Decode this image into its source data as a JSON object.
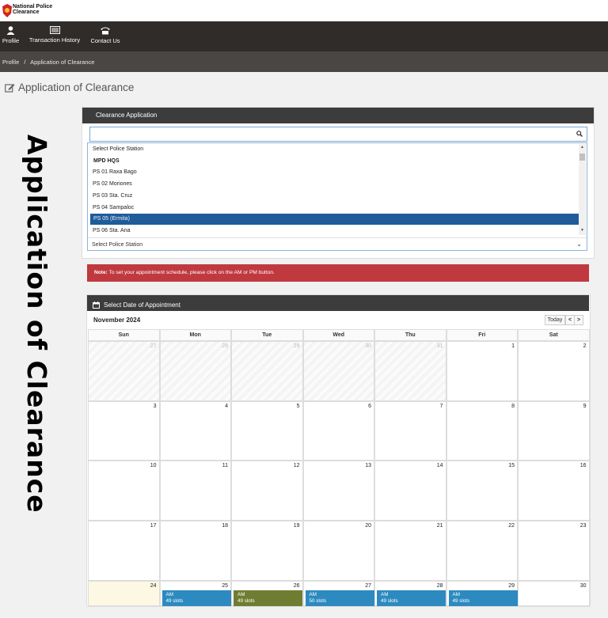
{
  "brand": {
    "line1": "National Police",
    "line2": "Clearance"
  },
  "nav": [
    {
      "label": "Profile",
      "icon": "user-icon"
    },
    {
      "label": "Transaction History",
      "icon": "list-icon"
    },
    {
      "label": "Contact Us",
      "icon": "phone-icon"
    }
  ],
  "breadcrumb": {
    "home": "Profile",
    "sep": "/",
    "current": "Application of Clearance"
  },
  "page_title": "Application of Clearance",
  "side_label": "Application of Clearance",
  "clearance_panel": {
    "title": "Clearance Application",
    "search_value": "",
    "options": [
      {
        "label": "Select Police Station",
        "style": "plain"
      },
      {
        "label": "MPD HQS",
        "style": "bold"
      },
      {
        "label": "PS 01 Raxa Bago",
        "style": "plain"
      },
      {
        "label": "PS 02 Moriones",
        "style": "plain"
      },
      {
        "label": "PS 03 Sta. Cruz",
        "style": "plain"
      },
      {
        "label": "PS 04 Sampaloc",
        "style": "plain"
      },
      {
        "label": "PS 05 (Ermita)",
        "style": "selected"
      },
      {
        "label": "PS 06 Sta. Ana",
        "style": "plain"
      }
    ],
    "select_value": "Select Police Station"
  },
  "note": {
    "prefix": "Note:",
    "text": " To set your appointment schedule, please click on the AM or PM button."
  },
  "calendar": {
    "title": "Select Date of Appointment",
    "month": "November 2024",
    "today_label": "Today",
    "prev_label": "<",
    "next_label": ">",
    "days": [
      "Sun",
      "Mon",
      "Tue",
      "Wed",
      "Thu",
      "Fri",
      "Sat"
    ],
    "weeks": [
      [
        {
          "d": "27",
          "o": true
        },
        {
          "d": "28",
          "o": true
        },
        {
          "d": "29",
          "o": true
        },
        {
          "d": "30",
          "o": true
        },
        {
          "d": "31",
          "o": true
        },
        {
          "d": "1"
        },
        {
          "d": "2"
        }
      ],
      [
        {
          "d": "3"
        },
        {
          "d": "4"
        },
        {
          "d": "5"
        },
        {
          "d": "6"
        },
        {
          "d": "7"
        },
        {
          "d": "8"
        },
        {
          "d": "9"
        }
      ],
      [
        {
          "d": "10"
        },
        {
          "d": "11"
        },
        {
          "d": "12"
        },
        {
          "d": "13"
        },
        {
          "d": "14"
        },
        {
          "d": "15"
        },
        {
          "d": "16"
        }
      ],
      [
        {
          "d": "17"
        },
        {
          "d": "18"
        },
        {
          "d": "19"
        },
        {
          "d": "20"
        },
        {
          "d": "21"
        },
        {
          "d": "22"
        },
        {
          "d": "23"
        }
      ],
      [
        {
          "d": "24",
          "today": true
        },
        {
          "d": "25",
          "slot": {
            "ampm": "AM",
            "text": "49 slots",
            "color": "blue"
          }
        },
        {
          "d": "26",
          "slot": {
            "ampm": "AM",
            "text": "49 slots",
            "color": "olive"
          }
        },
        {
          "d": "27",
          "slot": {
            "ampm": "AM",
            "text": "50 slots",
            "color": "blue"
          }
        },
        {
          "d": "28",
          "slot": {
            "ampm": "AM",
            "text": "49 slots",
            "color": "blue"
          }
        },
        {
          "d": "29",
          "slot": {
            "ampm": "AM",
            "text": "49 slots",
            "color": "blue"
          }
        },
        {
          "d": "30"
        }
      ]
    ]
  },
  "colors": {
    "nav_bg": "#2f2c2a",
    "note_bg": "#c0393f",
    "selected_bg": "#1f5c99",
    "slot_blue": "#2c8ac0",
    "slot_olive": "#6f7d33"
  }
}
